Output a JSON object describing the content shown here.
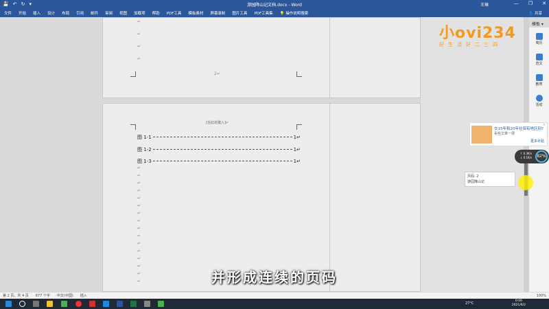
{
  "titlebar": {
    "quick_access": [
      "💾",
      "↶",
      "↻",
      "▾"
    ],
    "doc_title": "游园降山记文档.docx - Word",
    "user": "王琳",
    "window_buttons": [
      "—",
      "❐",
      "✕"
    ]
  },
  "menubar": {
    "items": [
      "文件",
      "开始",
      "插入",
      "设计",
      "布局",
      "引用",
      "邮件",
      "审阅",
      "视图",
      "加载项",
      "帮助",
      "PDF工具",
      "模板素材",
      "屏幕录制",
      "图片工具",
      "PDF工具集",
      "操作说明搜索"
    ],
    "share": "共享"
  },
  "document": {
    "page1": {
      "marks": [
        "↵",
        "↵",
        "↵",
        "↵"
      ],
      "page_number": "2↵"
    },
    "page2": {
      "header_hint": "[在此处键入]↵",
      "toc": [
        {
          "label": "图 1-1",
          "page": "1↵"
        },
        {
          "label": "图 1-2",
          "page": "1↵"
        },
        {
          "label": "图 1-3",
          "page": "1↵"
        }
      ],
      "marks": [
        "↵",
        "↵",
        "↵",
        "↵",
        "↵",
        "↵",
        "↵",
        "↵",
        "↵",
        "↵",
        "↵",
        "↵",
        "↵",
        "↵",
        "↵",
        "↵"
      ]
    }
  },
  "watermark": {
    "logo": "小ovi234",
    "slogan": "好生活好二三四"
  },
  "side_panel": {
    "header": "模板 ▾",
    "items": [
      {
        "label": "简历",
        "color": "#3b7ed0"
      },
      {
        "label": "范文",
        "color": "#3b7ed0"
      },
      {
        "label": "教育",
        "color": "#3b7ed0"
      },
      {
        "label": "活动",
        "color": "#3b7ed0"
      }
    ]
  },
  "ad": {
    "title": "交15年和20年社保有啥区别?",
    "subtitle": "看些文章一便",
    "more": "更多补贴",
    "close": "×"
  },
  "network_widget": {
    "up": "↑ 0.3K/s",
    "down": "↓ 0.1K/s",
    "percent": "82%"
  },
  "tooltip": {
    "line1": "页码: 2",
    "line2": "游园降山记"
  },
  "subtitle": "并形成连续的页码",
  "statusbar": {
    "page": "第 2 页，共 4 页",
    "words": "677 个字",
    "lang": "中文(中国)",
    "mode": "插入",
    "zoom": "100%"
  },
  "taskbar": {
    "temp": "27°C",
    "time": "0:06",
    "date": "2021/6/2"
  }
}
